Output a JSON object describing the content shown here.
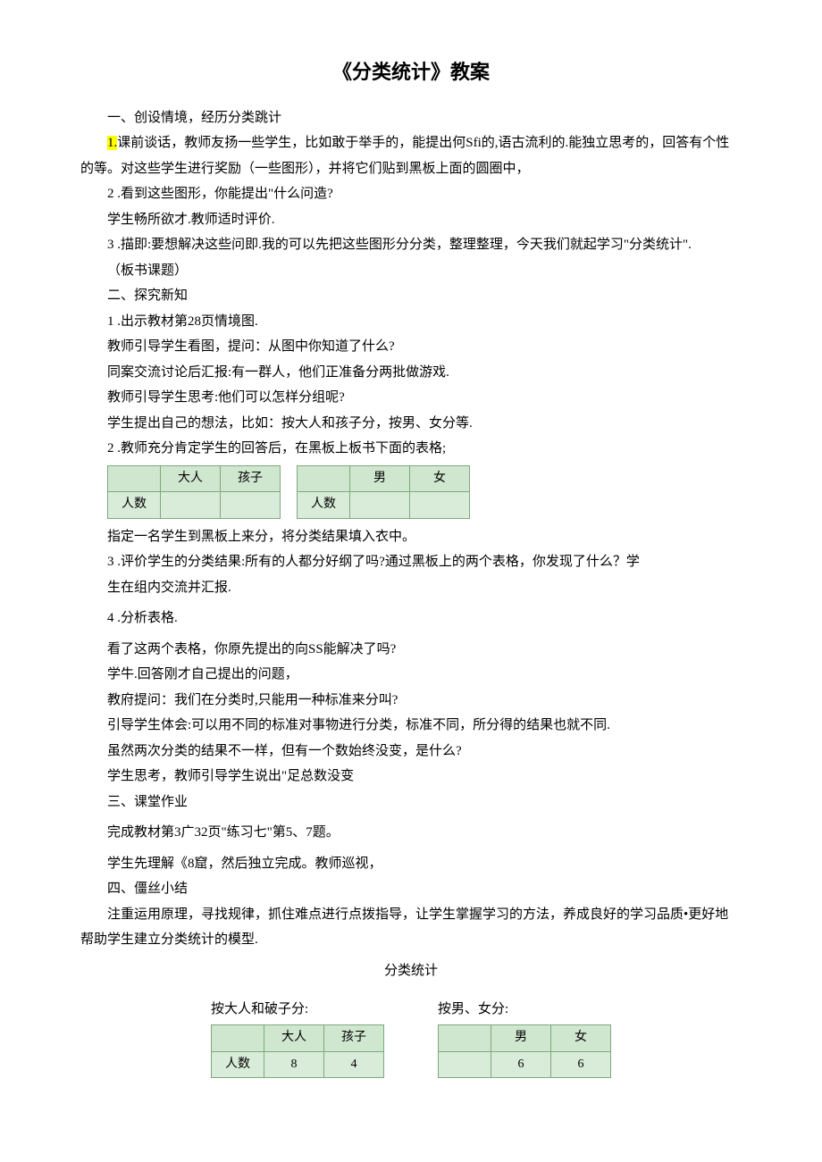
{
  "title": "《分类统计》教案",
  "p1": "一、创设情境，经历分类跳计",
  "p2a": "1.",
  "p2b": "课前谈话，教师友扬一些学生，比如敢于举手的，能提出何Sfi的,语古流利的.能独立思考的，回答有个性的等。对这些学生进行奖励（一些图形），并将它们贴到黑板上面的圆圈中，",
  "p3": "2 .看到这些图形，你能提出\"什么问造?",
  "p4": "学生畅所欲才.教师适时评价.",
  "p5": "3 .描即:要想解决这些问即.我的可以先把这些图形分分类，整理整理，今天我们就起学习\"分类统计\".",
  "p6": "（板书课题）",
  "p7": "二、探究新知",
  "p8": "1 .出示教材第28页情境图.",
  "p9": "教师引导学生看图，提问：从图中你知道了什么?",
  "p10": "同案交流讨论后汇报:有一群人，他们正准备分两批做游戏.",
  "p11": "教师引导学生思考:他们可以怎样分组呢?",
  "p12": "学生提出自己的想法，比如：按大人和孩子分，按男、女分等.",
  "p13": "2 .教师充分肯定学生的回答后，在黑板上板书下面的表格;",
  "table1": {
    "headers": [
      "",
      "大人",
      "孩子"
    ],
    "rowLabel": "人数",
    "cells": [
      "",
      ""
    ]
  },
  "table2": {
    "headers": [
      "",
      "男",
      "女"
    ],
    "rowLabel": "人数",
    "cells": [
      "",
      ""
    ]
  },
  "p14": "指定一名学生到黑板上来分，将分类结果填入衣中。",
  "p15": "3 .评价学生的分类结果:所有的人都分好纲了吗?通过黑板上的两个表格，你发现了什么？学",
  "p15b": "生在组内交流并汇报.",
  "p16": "4 .分析表格.",
  "p17": "看了这两个表格，你原先提出的向SS能解决了吗?",
  "p18": "学牛.回答刚才自己提出的问题，",
  "p19": "教府提问：我们在分类时,只能用一种标准来分叫?",
  "p20": "引导学生体会:可以用不同的标准对事物进行分类，标准不同，所分得的结果也就不同.",
  "p21": "虽然两次分类的结果不一样，但有一个数始终没变，是什么?",
  "p22": "学生思考，教师引导学生说出\"足总数没变",
  "p23": "三、课堂作业",
  "p24": "完成教材第3广32页\"练习七\"第5、7题。",
  "p25": "学生先理解《8窟，然后独立完成。教师巡视，",
  "p26": "四、僵丝小结",
  "p27": "注重运用原理，寻找规律，抓住难点进行点拨指导，让学生掌握学习的方法，养成良好的学习品质•更好地帮助学生建立分类统计的模型.",
  "summaryTitle": "分类统计",
  "bottomLeftLabel": "按大人和破子分:",
  "bottomRightLabel": "按男、女分:",
  "table3": {
    "headers": [
      "",
      "大人",
      "孩子"
    ],
    "rowLabel": "人数",
    "cells": [
      "8",
      "4"
    ]
  },
  "table4": {
    "headers": [
      "",
      "男",
      "女"
    ],
    "rowLabel": "",
    "cells": [
      "6",
      "6"
    ]
  }
}
